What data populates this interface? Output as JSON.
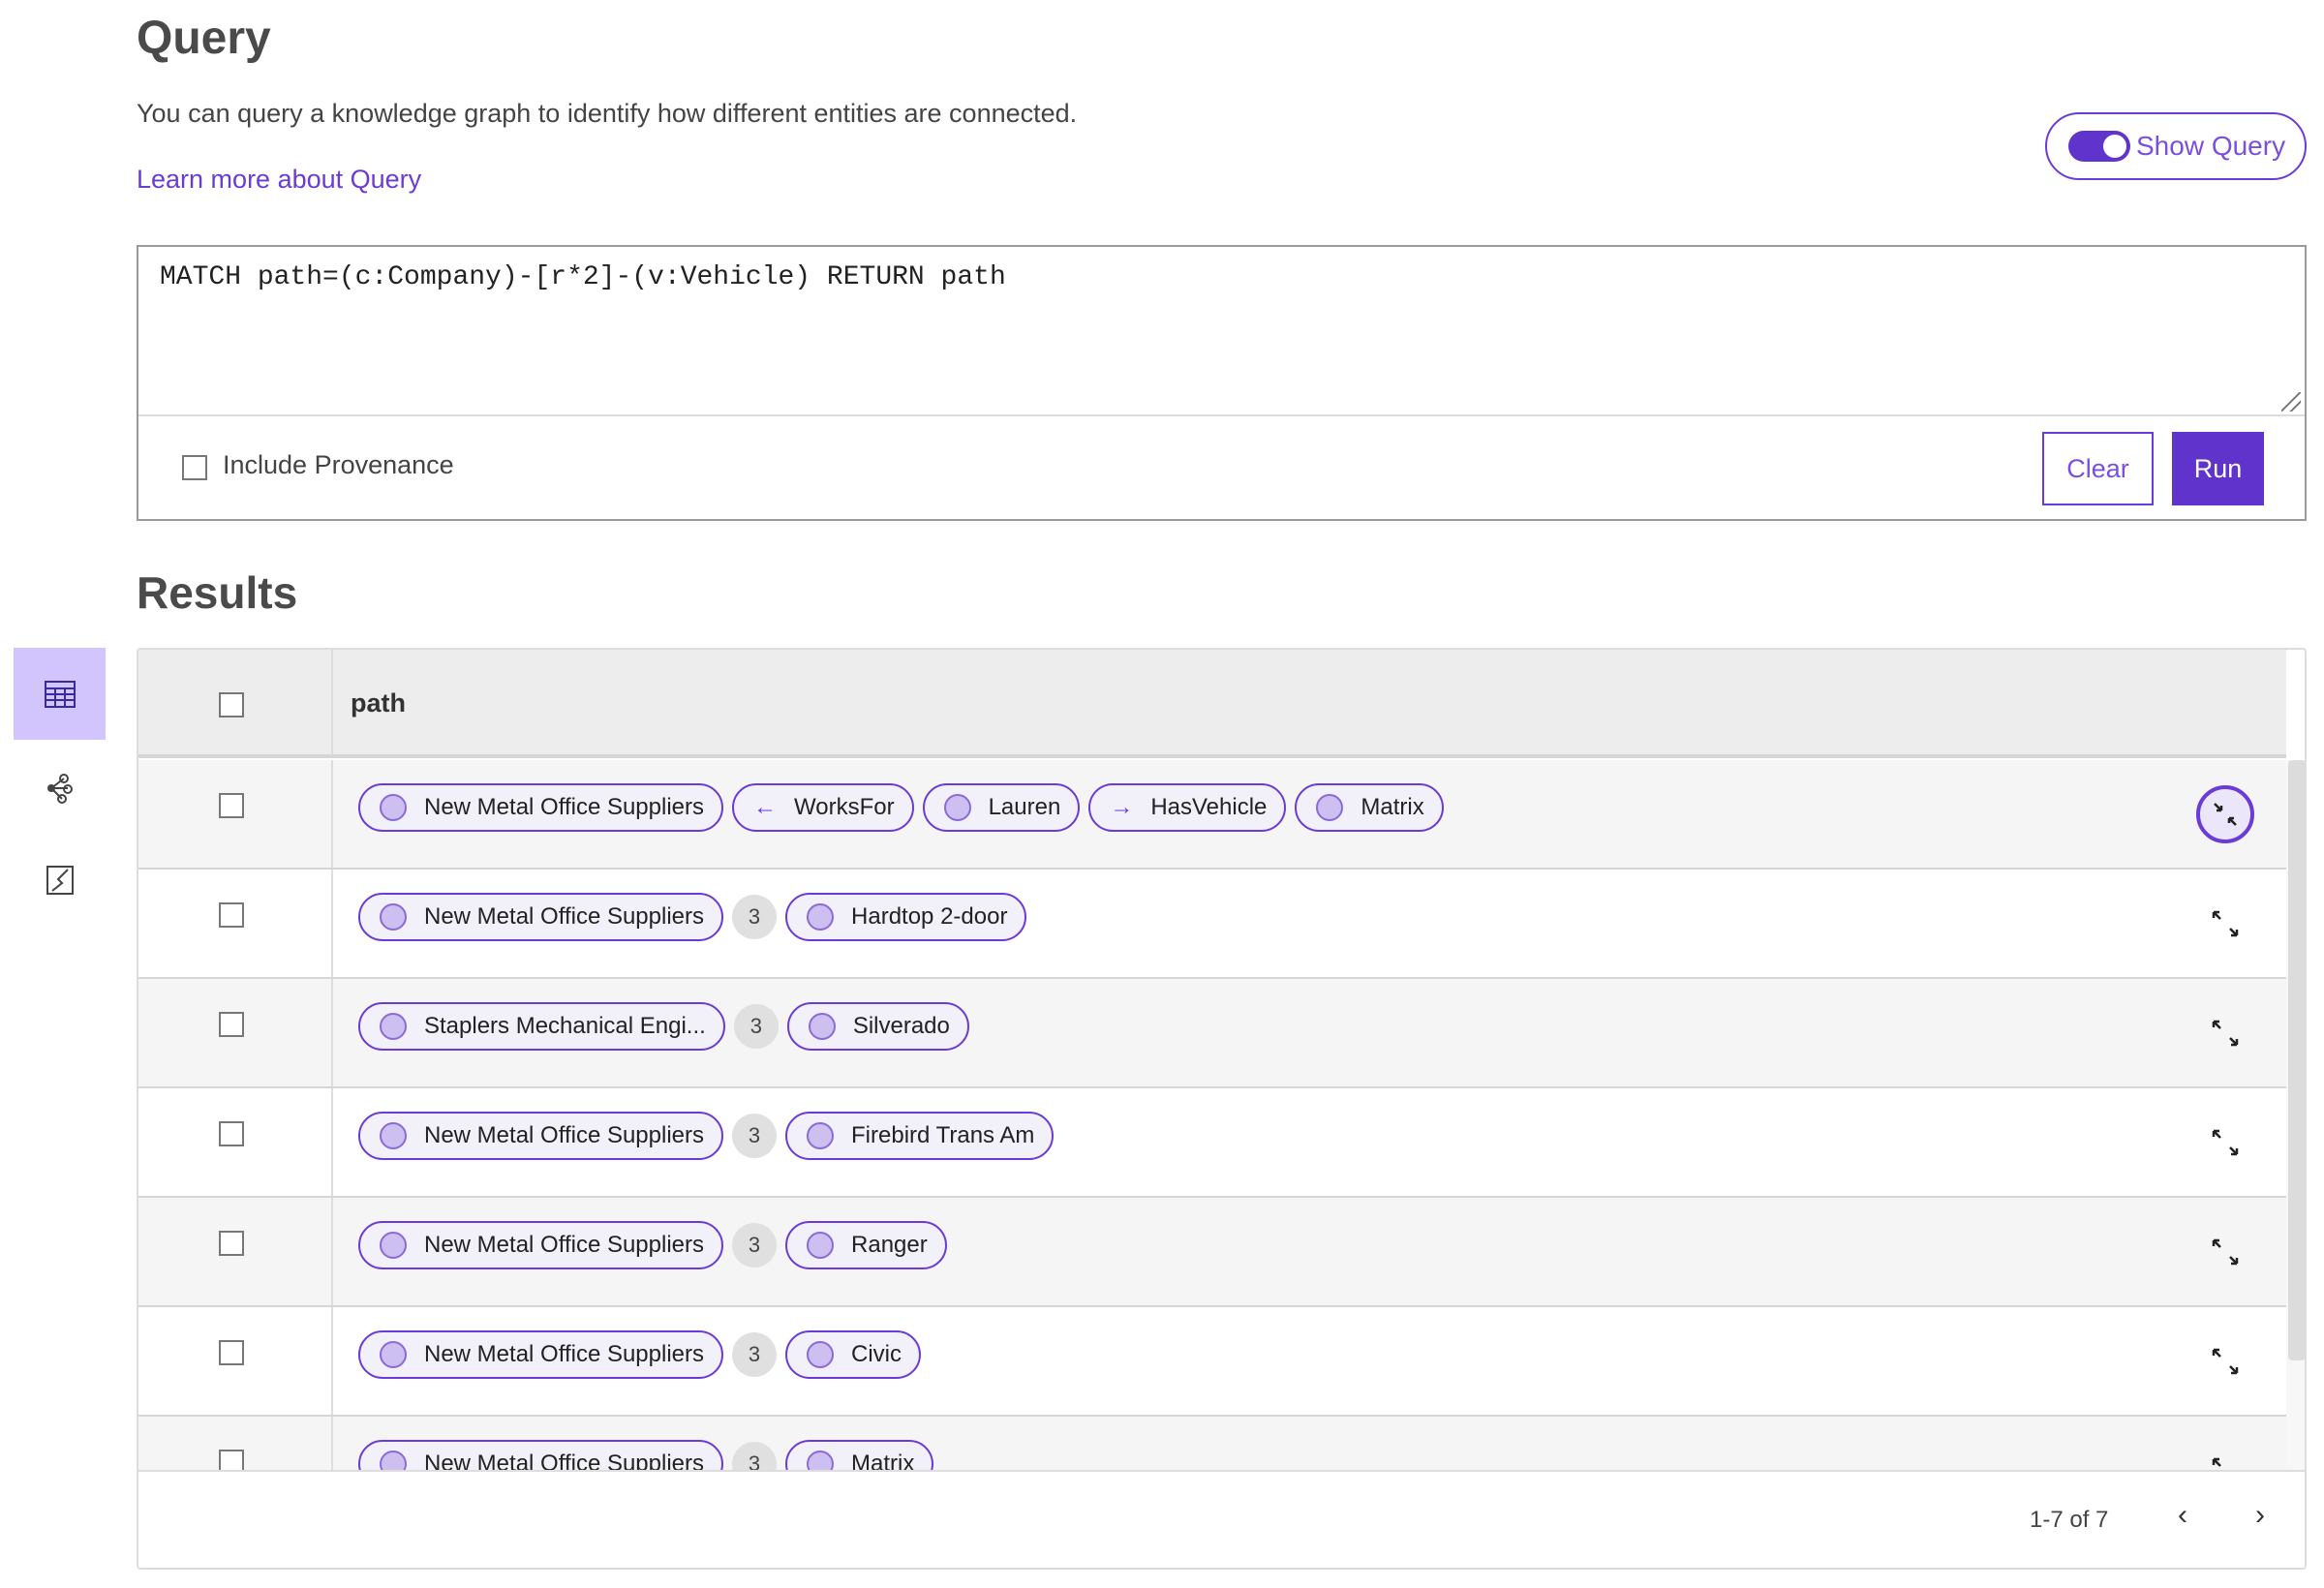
{
  "header": {
    "title": "Query",
    "description": "You can query a knowledge graph to identify how different entities are connected.",
    "learn_more": "Learn more about Query",
    "show_query_label": "Show Query",
    "show_query_on": true
  },
  "query": {
    "text": "MATCH path=(c:Company)-[r*2]-(v:Vehicle) RETURN path",
    "include_provenance_label": "Include Provenance",
    "include_provenance": false,
    "clear_label": "Clear",
    "run_label": "Run"
  },
  "results": {
    "title": "Results",
    "column": "path",
    "rows": [
      {
        "items": [
          {
            "type": "node",
            "label": "New Metal Office Suppliers"
          },
          {
            "type": "rel",
            "arrow": "←",
            "label": "WorksFor"
          },
          {
            "type": "node",
            "label": "Lauren"
          },
          {
            "type": "rel",
            "arrow": "→",
            "label": "HasVehicle"
          },
          {
            "type": "node",
            "label": "Matrix"
          }
        ],
        "expanded": true
      },
      {
        "items": [
          {
            "type": "node",
            "label": "New Metal Office Suppliers"
          },
          {
            "type": "count",
            "label": "3"
          },
          {
            "type": "node",
            "label": "Hardtop 2-door"
          }
        ]
      },
      {
        "items": [
          {
            "type": "node",
            "label": "Staplers Mechanical Engi..."
          },
          {
            "type": "count",
            "label": "3"
          },
          {
            "type": "node",
            "label": "Silverado"
          }
        ]
      },
      {
        "items": [
          {
            "type": "node",
            "label": "New Metal Office Suppliers"
          },
          {
            "type": "count",
            "label": "3"
          },
          {
            "type": "node",
            "label": "Firebird Trans Am"
          }
        ]
      },
      {
        "items": [
          {
            "type": "node",
            "label": "New Metal Office Suppliers"
          },
          {
            "type": "count",
            "label": "3"
          },
          {
            "type": "node",
            "label": "Ranger"
          }
        ]
      },
      {
        "items": [
          {
            "type": "node",
            "label": "New Metal Office Suppliers"
          },
          {
            "type": "count",
            "label": "3"
          },
          {
            "type": "node",
            "label": "Civic"
          }
        ]
      },
      {
        "items": [
          {
            "type": "node",
            "label": "New Metal Office Suppliers"
          },
          {
            "type": "count",
            "label": "3"
          },
          {
            "type": "node",
            "label": "Matrix"
          }
        ]
      }
    ],
    "pagination": "1-7 of 7",
    "prev_icon": "chevron-left-icon",
    "next_icon": "chevron-right-icon"
  },
  "sidebar": {
    "items": [
      {
        "icon": "table-icon",
        "active": true
      },
      {
        "icon": "graph-icon"
      },
      {
        "icon": "chart-icon"
      }
    ]
  },
  "colors": {
    "accent": "#6033cc",
    "accent_light": "#d2c4fc",
    "chip_border": "#6a3bd6"
  }
}
